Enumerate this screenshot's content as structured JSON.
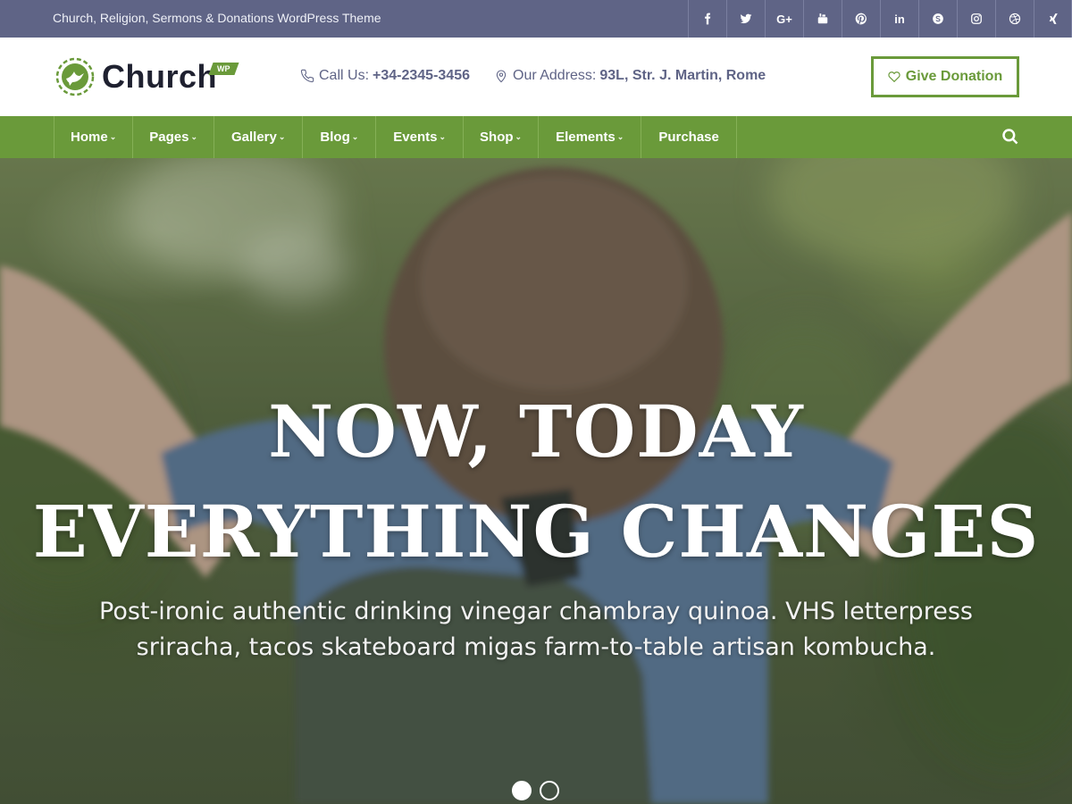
{
  "topbar": {
    "tagline": "Church, Religion, Sermons & Donations WordPress Theme",
    "social": [
      {
        "icon": "facebook-icon",
        "glyph": "f"
      },
      {
        "icon": "twitter-icon",
        "glyph": "t"
      },
      {
        "icon": "google-plus-icon",
        "glyph": "G+"
      },
      {
        "icon": "youtube-icon",
        "glyph": "yt"
      },
      {
        "icon": "pinterest-icon",
        "glyph": "p"
      },
      {
        "icon": "linkedin-icon",
        "glyph": "in"
      },
      {
        "icon": "skype-icon",
        "glyph": "S"
      },
      {
        "icon": "instagram-icon",
        "glyph": "ig"
      },
      {
        "icon": "dribbble-icon",
        "glyph": "d"
      },
      {
        "icon": "xing-icon",
        "glyph": "x"
      }
    ]
  },
  "header": {
    "logo_text": "Church",
    "logo_badge": "WP",
    "phone_label": "Call Us:",
    "phone_value": "+34-2345-3456",
    "address_label": "Our Address:",
    "address_value": "93L, Str. J. Martin, Rome",
    "donate_label": "Give Donation"
  },
  "nav": {
    "items": [
      {
        "label": "Home",
        "has_dropdown": true
      },
      {
        "label": "Pages",
        "has_dropdown": true
      },
      {
        "label": "Gallery",
        "has_dropdown": true
      },
      {
        "label": "Blog",
        "has_dropdown": true
      },
      {
        "label": "Events",
        "has_dropdown": true
      },
      {
        "label": "Shop",
        "has_dropdown": true
      },
      {
        "label": "Elements",
        "has_dropdown": true
      },
      {
        "label": "Purchase",
        "has_dropdown": false
      }
    ],
    "caret": "⌄"
  },
  "hero": {
    "title_line1": "NOW, TODAY",
    "title_line2": "EVERYTHING CHANGES",
    "subtitle_line1": "Post-ironic authentic drinking vinegar chambray quinoa. VHS letterpress",
    "subtitle_line2": "sriracha, tacos skateboard migas farm-to-table artisan kombucha.",
    "slides_total": 2,
    "slide_active": 1
  },
  "colors": {
    "topbar": "#5f6486",
    "accent_green": "#6a9a3a",
    "text_dark": "#1f2130"
  }
}
